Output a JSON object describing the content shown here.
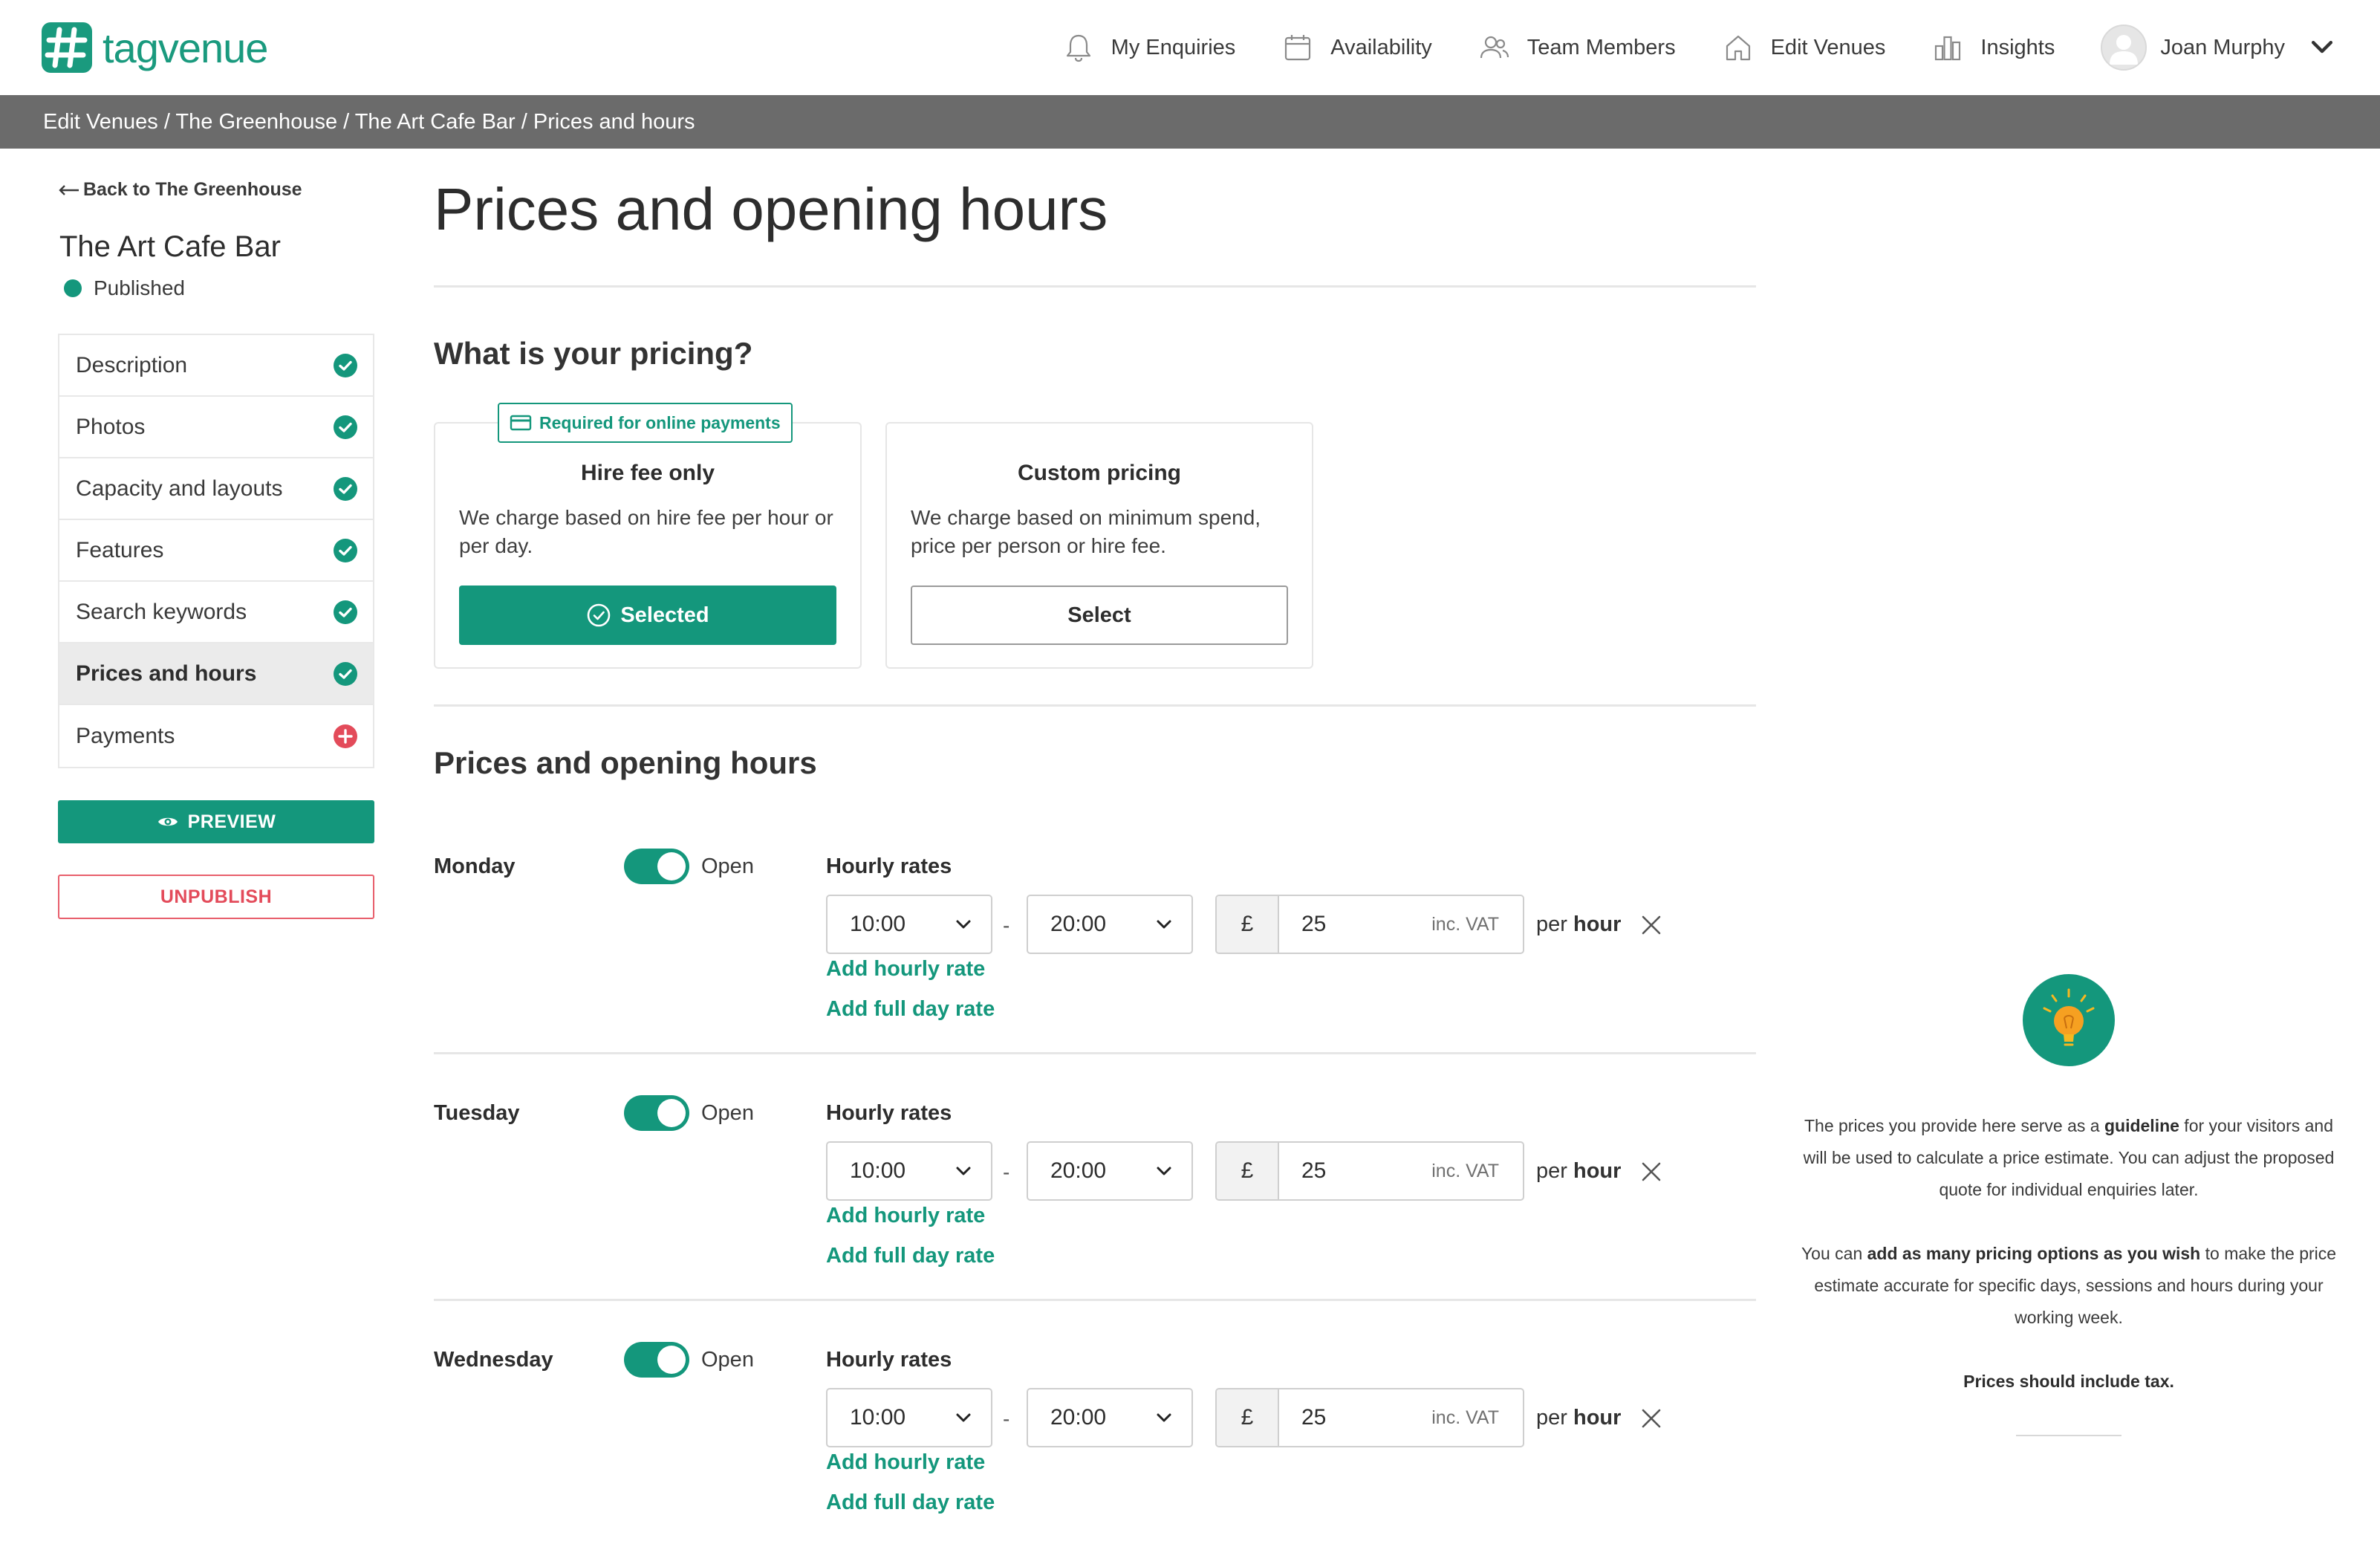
{
  "header": {
    "logo_text": "tagvenue",
    "nav": [
      {
        "label": "My Enquiries",
        "icon": "bell-icon"
      },
      {
        "label": "Availability",
        "icon": "calendar-icon"
      },
      {
        "label": "Team Members",
        "icon": "users-icon"
      },
      {
        "label": "Edit Venues",
        "icon": "home-icon"
      },
      {
        "label": "Insights",
        "icon": "bar-chart-icon"
      }
    ],
    "user_name": "Joan Murphy"
  },
  "breadcrumb": "Edit Venues / The Greenhouse / The Art Cafe Bar / Prices and hours",
  "sidebar": {
    "back_label": "Back to The Greenhouse",
    "venue_name": "The Art Cafe Bar",
    "status": "Published",
    "items": [
      {
        "label": "Description",
        "state": "complete"
      },
      {
        "label": "Photos",
        "state": "complete"
      },
      {
        "label": "Capacity and layouts",
        "state": "complete"
      },
      {
        "label": "Features",
        "state": "complete"
      },
      {
        "label": "Search keywords",
        "state": "complete"
      },
      {
        "label": "Prices and hours",
        "state": "complete",
        "active": true
      },
      {
        "label": "Payments",
        "state": "incomplete"
      }
    ],
    "preview_label": "PREVIEW",
    "unpublish_label": "UNPUBLISH"
  },
  "main": {
    "title": "Prices and opening hours",
    "pricing_heading": "What is your pricing?",
    "options": [
      {
        "badge": "Required for online payments",
        "title": "Hire fee only",
        "description": "We charge based on hire fee per hour or per day.",
        "button": "Selected"
      },
      {
        "title": "Custom pricing",
        "description": "We charge based on minimum spend, price per person or hire fee.",
        "button": "Select"
      }
    ],
    "hours_heading": "Prices and opening hours",
    "days": [
      {
        "name": "Monday",
        "open_label": "Open",
        "rates_label": "Hourly rates",
        "from": "10:00",
        "to": "20:00",
        "currency": "£",
        "price": "25",
        "vat": "inc. VAT",
        "per": "per",
        "unit": "hour",
        "add_hourly": "Add hourly rate",
        "add_full_day": "Add full day rate"
      },
      {
        "name": "Tuesday",
        "open_label": "Open",
        "rates_label": "Hourly rates",
        "from": "10:00",
        "to": "20:00",
        "currency": "£",
        "price": "25",
        "vat": "inc. VAT",
        "per": "per",
        "unit": "hour",
        "add_hourly": "Add hourly rate",
        "add_full_day": "Add full day rate"
      },
      {
        "name": "Wednesday",
        "open_label": "Open",
        "rates_label": "Hourly rates",
        "from": "10:00",
        "to": "20:00",
        "currency": "£",
        "price": "25",
        "vat": "inc. VAT",
        "per": "per",
        "unit": "hour",
        "add_hourly": "Add hourly rate",
        "add_full_day": "Add full day rate"
      }
    ],
    "separator": "-"
  },
  "tips": {
    "p1_a": "The prices you provide here serve as a ",
    "p1_b": "guideline",
    "p1_c": " for your visitors and will be used to calculate a price estimate. You can adjust the proposed quote for individual enquiries later.",
    "p2_a": "You can ",
    "p2_b": "add as many pricing options as you wish",
    "p2_c": " to make the price estimate accurate for specific days, sessions and hours during your working week.",
    "p3": "Prices should include tax."
  },
  "colors": {
    "brand": "#14977c",
    "danger": "#e34b5a",
    "breadcrumb_bg": "#6b6b6b"
  }
}
